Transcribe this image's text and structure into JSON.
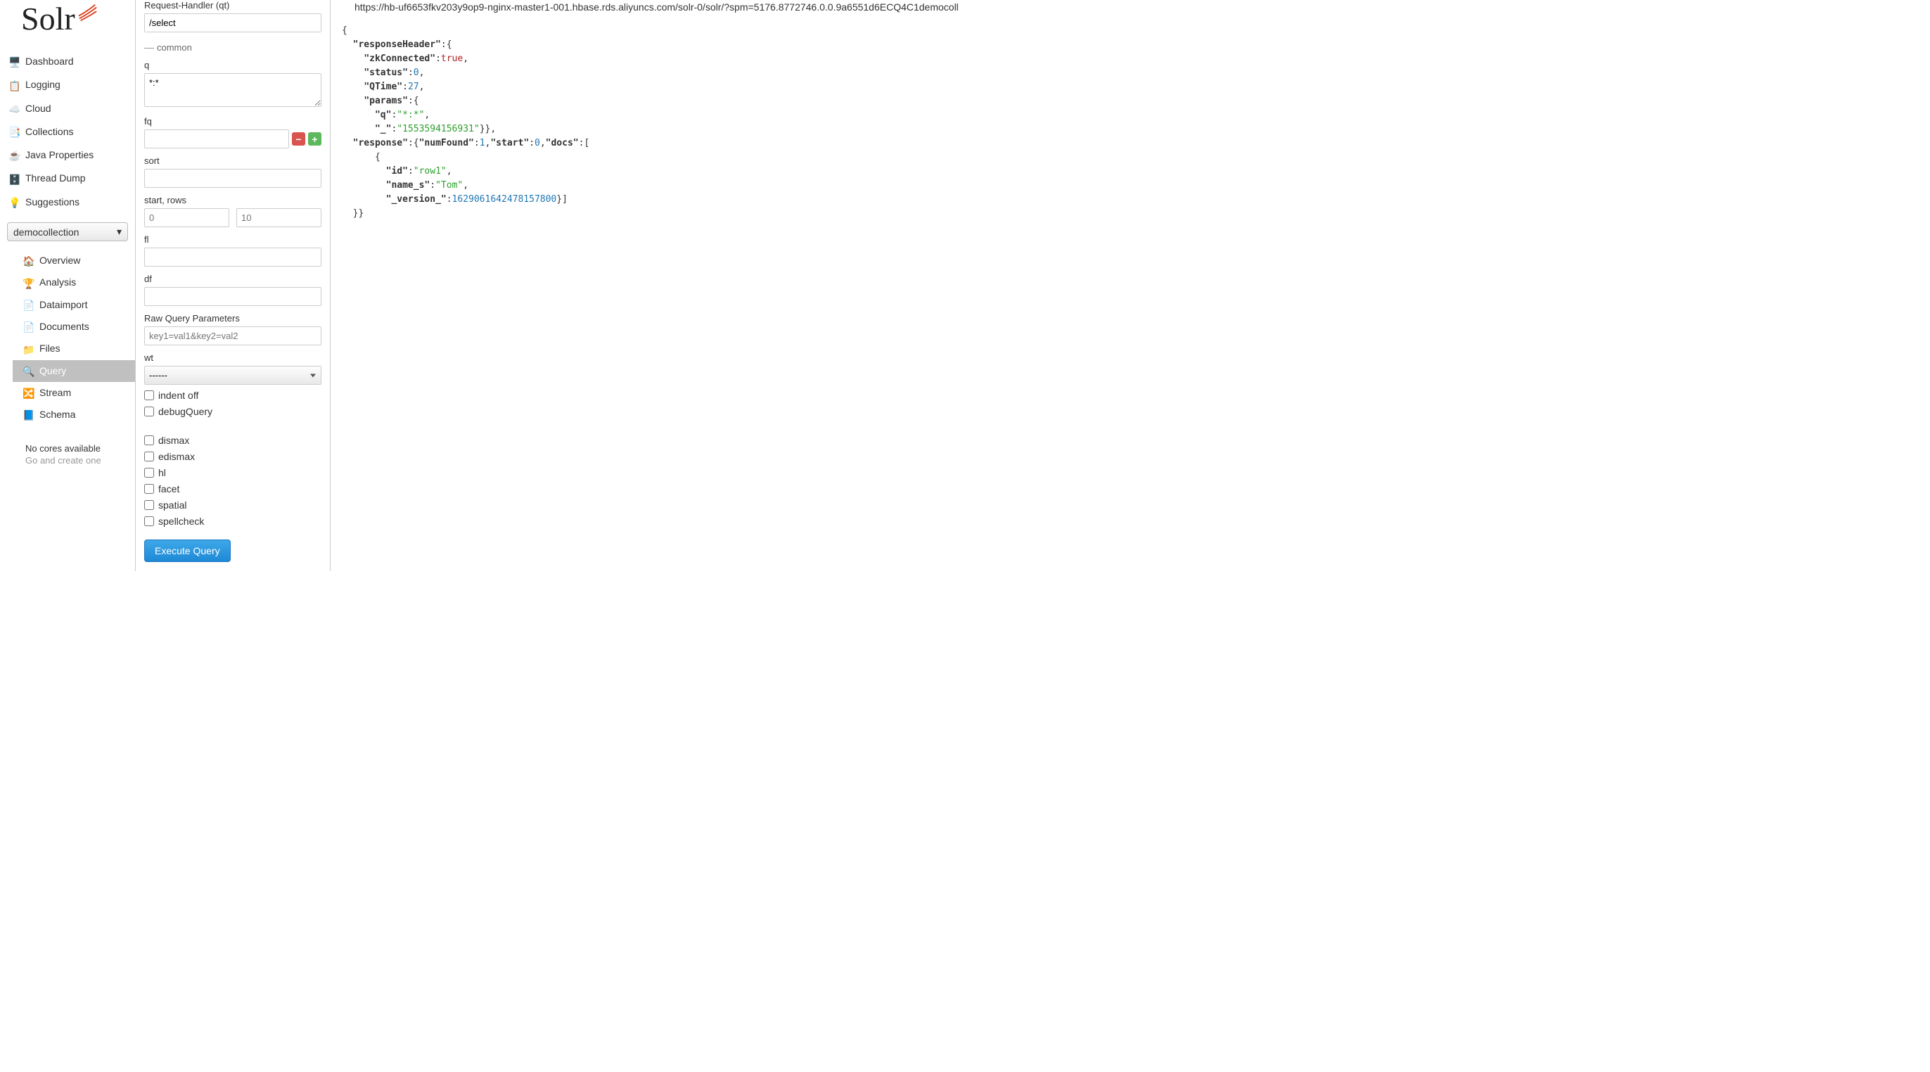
{
  "logo_text": "Solr",
  "nav": [
    {
      "label": "Dashboard"
    },
    {
      "label": "Logging"
    },
    {
      "label": "Cloud"
    },
    {
      "label": "Collections"
    },
    {
      "label": "Java Properties"
    },
    {
      "label": "Thread Dump"
    },
    {
      "label": "Suggestions"
    }
  ],
  "core_selector": "democollection",
  "sub_nav": [
    {
      "label": "Overview"
    },
    {
      "label": "Analysis"
    },
    {
      "label": "Dataimport"
    },
    {
      "label": "Documents"
    },
    {
      "label": "Files"
    },
    {
      "label": "Query",
      "active": true
    },
    {
      "label": "Stream"
    },
    {
      "label": "Schema"
    }
  ],
  "no_cores": {
    "title": "No cores available",
    "sub": "Go and create one"
  },
  "query": {
    "qt_label": "Request-Handler (qt)",
    "qt_value": "/select",
    "common_legend": "common",
    "q_label": "q",
    "q_value": "*:*",
    "fq_label": "fq",
    "sort_label": "sort",
    "startrows_label": "start, rows",
    "start_placeholder": "0",
    "rows_placeholder": "10",
    "fl_label": "fl",
    "df_label": "df",
    "raw_label": "Raw Query Parameters",
    "raw_placeholder": "key1=val1&key2=val2",
    "wt_label": "wt",
    "wt_value": "------",
    "cb_indent": "indent off",
    "cb_debug": "debugQuery",
    "cb_dismax": "dismax",
    "cb_edismax": "edismax",
    "cb_hl": "hl",
    "cb_facet": "facet",
    "cb_spatial": "spatial",
    "cb_spellcheck": "spellcheck",
    "execute": "Execute Query"
  },
  "result": {
    "url": "https://hb-uf6653fkv203y9op9-nginx-master1-001.hbase.rds.aliyuncs.com/solr-0/solr/?spm=5176.8772746.0.0.9a6551d6ECQ4C1democoll",
    "json": {
      "responseHeader": {
        "zkConnected": true,
        "status": 0,
        "QTime": 27,
        "params": {
          "q": "*:*",
          "_": "1553594156931"
        }
      },
      "response": {
        "numFound": 1,
        "start": 0,
        "docs": [
          {
            "id": "row1",
            "name_s": "Tom",
            "_version_": 1629061642478157824
          }
        ]
      }
    }
  }
}
